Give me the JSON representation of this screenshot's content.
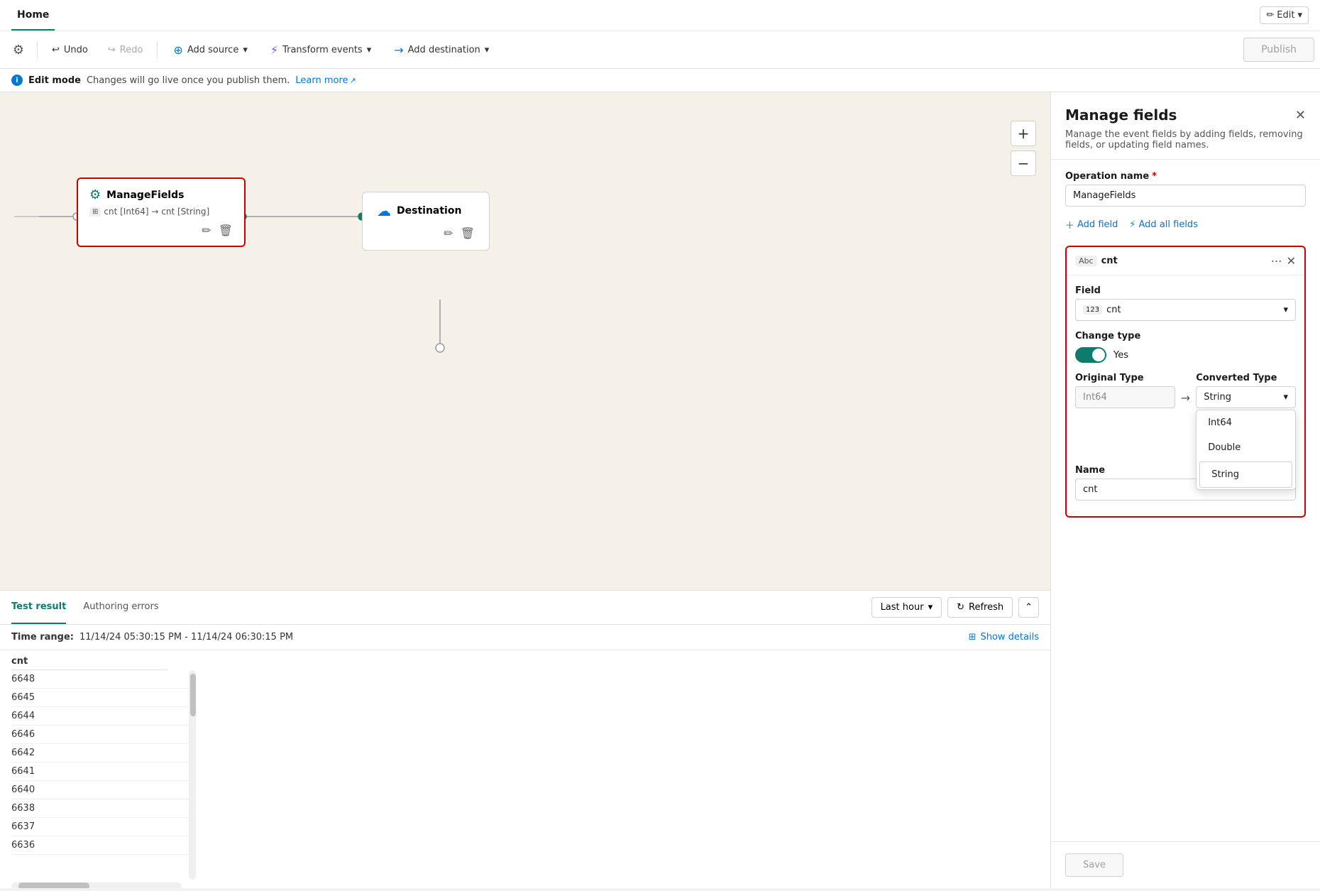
{
  "header": {
    "home_label": "Home",
    "edit_label": "Edit",
    "pencil_icon": "✏"
  },
  "toolbar": {
    "settings_icon": "⚙",
    "undo_label": "Undo",
    "redo_label": "Redo",
    "add_source_label": "Add source",
    "transform_events_label": "Transform events",
    "add_destination_label": "Add destination",
    "publish_label": "Publish"
  },
  "edit_mode": {
    "badge": "Edit mode",
    "description": "Changes will go live once you publish them.",
    "learn_more": "Learn more"
  },
  "canvas": {
    "node_manage": {
      "title": "ManageFields",
      "subtitle": "cnt [Int64] → cnt [String]"
    },
    "node_destination": {
      "title": "Destination"
    },
    "plus_icon": "+",
    "minus_icon": "−"
  },
  "bottom_panel": {
    "tab_test": "Test result",
    "tab_authoring": "Authoring errors",
    "last_hour_label": "Last hour",
    "refresh_label": "Refresh",
    "time_range_label": "Time range:",
    "time_range_value": "11/14/24 05:30:15 PM - 11/14/24 06:30:15 PM",
    "show_details_label": "Show details",
    "table_col": "cnt",
    "table_rows": [
      "6648",
      "6645",
      "6644",
      "6646",
      "6642",
      "6641",
      "6640",
      "6638",
      "6637",
      "6636"
    ]
  },
  "manage_fields_panel": {
    "title": "Manage fields",
    "description": "Manage the event fields by adding fields, removing fields, or updating field names.",
    "operation_name_label": "Operation name",
    "operation_name_required": "*",
    "operation_name_value": "ManageFields",
    "add_field_label": "Add field",
    "add_all_fields_label": "Add all fields",
    "field_card": {
      "icon": "Abc",
      "title": "cnt",
      "field_label": "Field",
      "field_value": "cnt",
      "field_icon": "123",
      "change_type_label": "Change type",
      "toggle_value": "Yes",
      "original_type_label": "Original Type",
      "original_type_value": "Int64",
      "converted_type_label": "Converted Type",
      "converted_type_value": "String",
      "name_label": "Name",
      "name_value": "cnt",
      "dropdown_options": [
        "Int64",
        "Double",
        "String"
      ],
      "selected_option": "String"
    },
    "save_label": "Save"
  }
}
